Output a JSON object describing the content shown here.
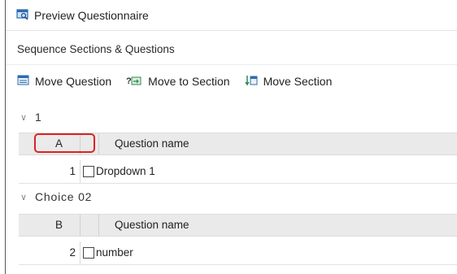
{
  "window": {
    "title": "Preview Questionnaire",
    "title_icon": "preview-icon"
  },
  "subtitle": "Sequence Sections & Questions",
  "toolbar": {
    "move_question": {
      "label": "Move Question",
      "icon": "move-question-icon"
    },
    "move_to_section": {
      "label": "Move to Section",
      "icon": "move-to-section-icon"
    },
    "move_section": {
      "label": "Move Section",
      "icon": "move-section-icon"
    }
  },
  "sections": [
    {
      "name": "1",
      "header": {
        "letter": "A",
        "question_name": "Question name"
      },
      "rows": [
        {
          "number": "1",
          "checked": false,
          "name": "Dropdown 1"
        }
      ]
    },
    {
      "name": "Choice 02",
      "header": {
        "letter": "B",
        "question_name": "Question name"
      },
      "rows": [
        {
          "number": "2",
          "checked": false,
          "name": "number"
        }
      ]
    }
  ],
  "colors": {
    "highlight": "#e02020",
    "header_bg": "#eaeaea",
    "accent_blue": "#2b6cb0"
  }
}
